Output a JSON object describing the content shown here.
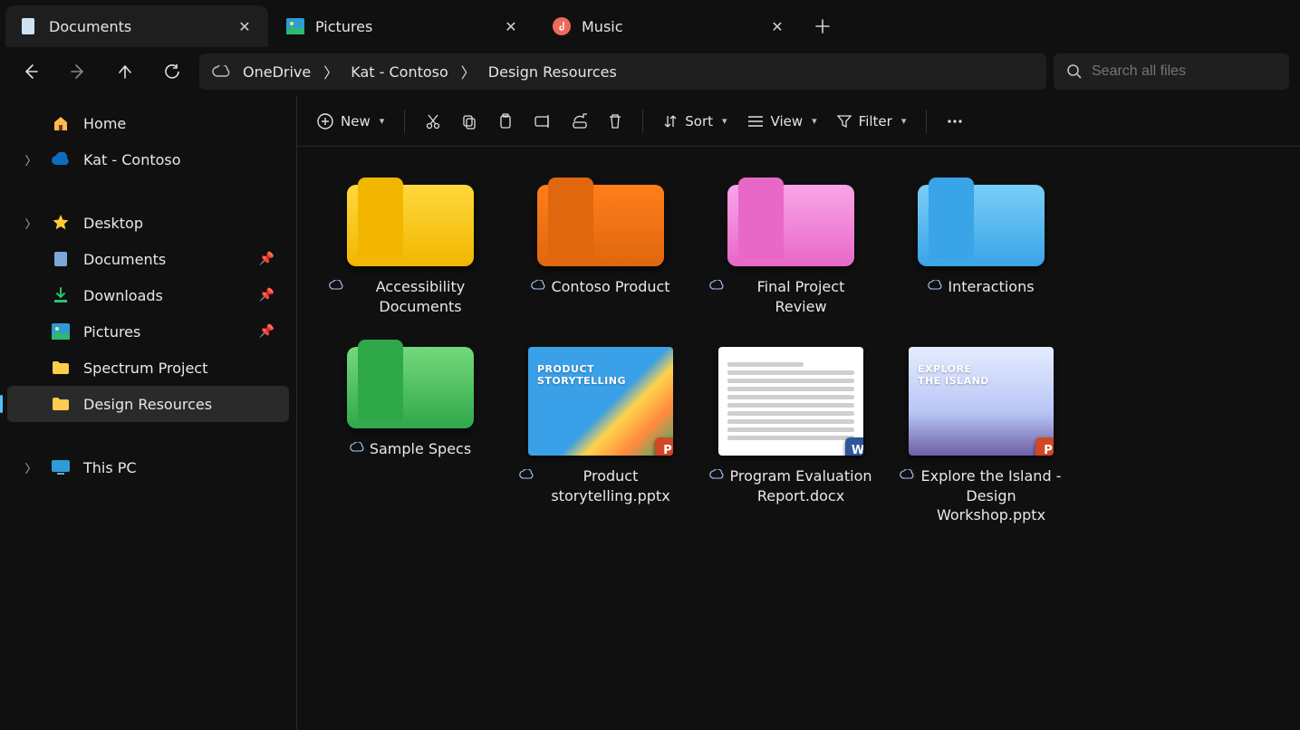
{
  "tabs": [
    {
      "label": "Documents",
      "active": true,
      "icon": "documents"
    },
    {
      "label": "Pictures",
      "active": false,
      "icon": "pictures"
    },
    {
      "label": "Music",
      "active": false,
      "icon": "music"
    }
  ],
  "breadcrumb": [
    "OneDrive",
    "Kat - Contoso",
    "Design Resources"
  ],
  "search": {
    "placeholder": "Search all files"
  },
  "toolbar": {
    "new": "New",
    "sort": "Sort",
    "view": "View",
    "filter": "Filter"
  },
  "sidebar": {
    "top": [
      {
        "label": "Home",
        "icon": "home",
        "chev": false
      },
      {
        "label": "Kat - Contoso",
        "icon": "onedrive",
        "chev": true
      }
    ],
    "quick": [
      {
        "label": "Desktop",
        "icon": "desktop",
        "chev": true,
        "pinned": false
      },
      {
        "label": "Documents",
        "icon": "documents",
        "chev": false,
        "pinned": true
      },
      {
        "label": "Downloads",
        "icon": "downloads",
        "chev": false,
        "pinned": true
      },
      {
        "label": "Pictures",
        "icon": "pictures",
        "chev": false,
        "pinned": true
      },
      {
        "label": "Spectrum Project",
        "icon": "folder",
        "chev": false,
        "pinned": false
      },
      {
        "label": "Design Resources",
        "icon": "folder",
        "chev": false,
        "pinned": false,
        "selected": true
      }
    ],
    "bottom": [
      {
        "label": "This PC",
        "icon": "thispc",
        "chev": true
      }
    ]
  },
  "folders": [
    {
      "name": "Accessibility Documents",
      "color_back": "#f2b600",
      "color_front": "#ffd83d"
    },
    {
      "name": "Contoso Product",
      "color_back": "#e0670e",
      "color_front": "#ff7e1b"
    },
    {
      "name": "Final Project Review",
      "color_back": "#e768c7",
      "color_front": "#f9a5e9"
    },
    {
      "name": "Interactions",
      "color_back": "#3aa4e8",
      "color_front": "#79cef8"
    },
    {
      "name": "Sample Specs",
      "color_back": "#2fa84a",
      "color_front": "#74d97c"
    }
  ],
  "files": [
    {
      "name": "Product storytelling.pptx",
      "kind": "ppt",
      "thumb": "ppt-blue",
      "overlay": "PRODUCT\nSTORYTELLING"
    },
    {
      "name": "Program Evaluation Report.docx",
      "kind": "doc",
      "thumb": "docpage"
    },
    {
      "name": "Explore the Island - Design Workshop.pptx",
      "kind": "ppt",
      "thumb": "island",
      "overlay": "EXPLORE\nTHE ISLAND"
    }
  ]
}
